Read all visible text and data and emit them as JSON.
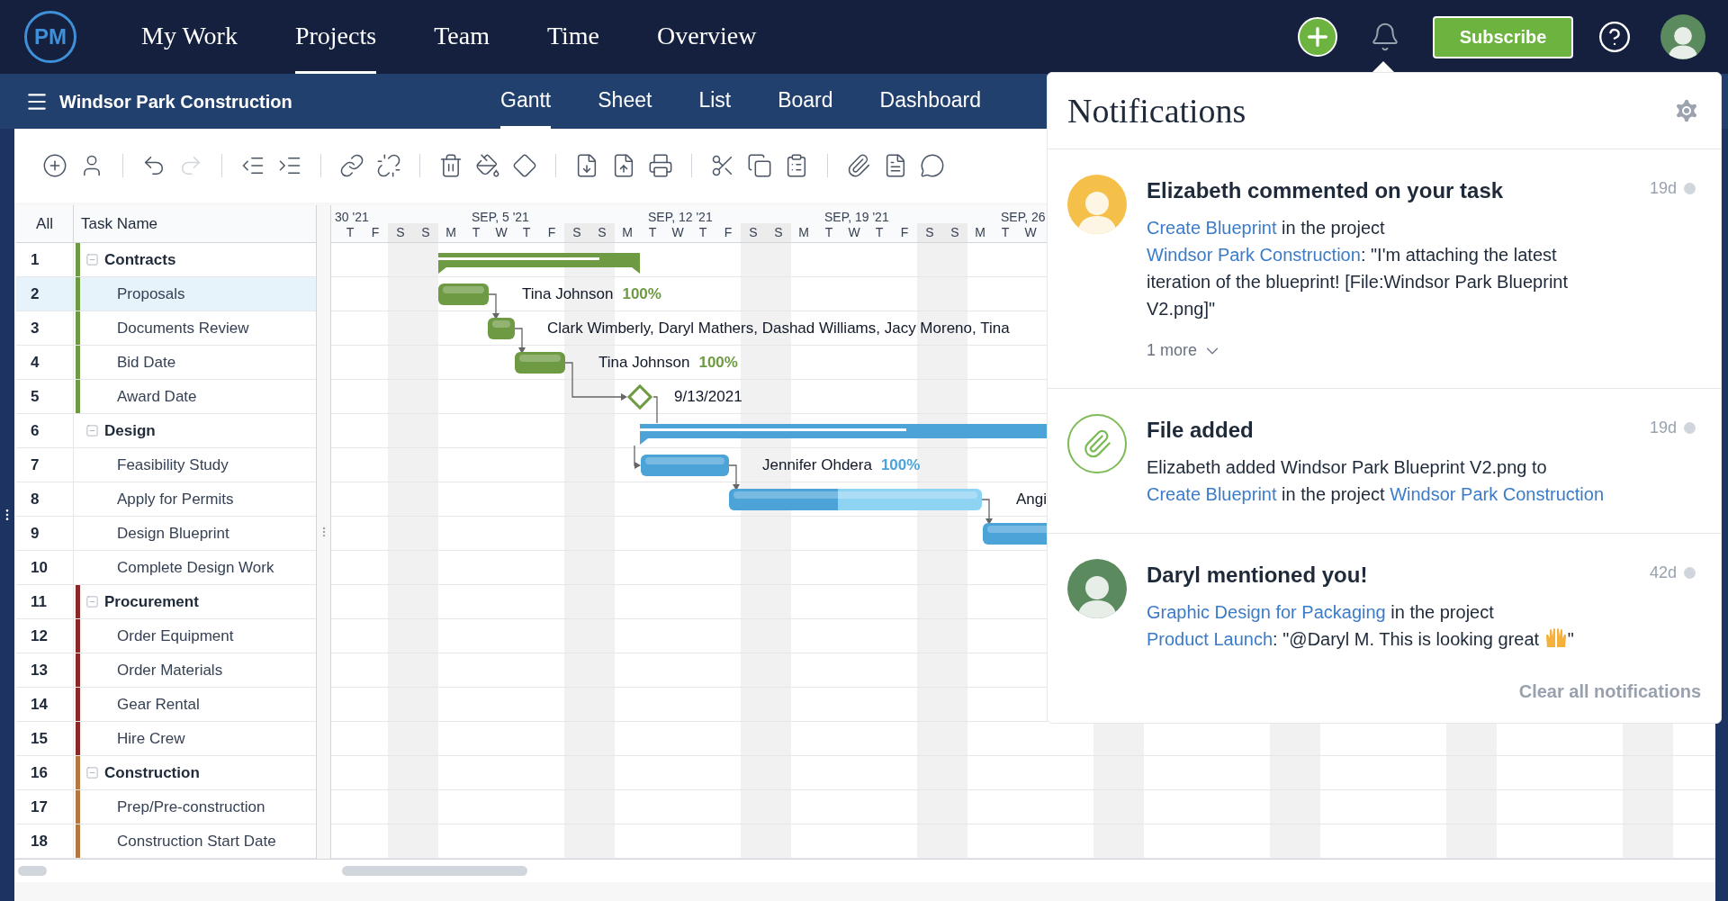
{
  "app": {
    "logo": "PM",
    "nav": [
      {
        "label": "My Work",
        "selected": false
      },
      {
        "label": "Projects",
        "selected": true
      },
      {
        "label": "Team",
        "selected": false
      },
      {
        "label": "Time",
        "selected": false
      },
      {
        "label": "Overview",
        "selected": false
      }
    ],
    "subscribe": "Subscribe"
  },
  "project": {
    "title": "Windsor Park Construction",
    "views": [
      {
        "label": "Gantt",
        "selected": true
      },
      {
        "label": "Sheet",
        "selected": false
      },
      {
        "label": "List",
        "selected": false
      },
      {
        "label": "Board",
        "selected": false
      },
      {
        "label": "Dashboard",
        "selected": false
      }
    ]
  },
  "toolbar": [
    {
      "kind": "add",
      "disabled": false
    },
    {
      "kind": "user",
      "disabled": false
    },
    {
      "kind": "sep"
    },
    {
      "kind": "undo",
      "disabled": false
    },
    {
      "kind": "redo",
      "disabled": true
    },
    {
      "kind": "sep"
    },
    {
      "kind": "outdent",
      "disabled": false
    },
    {
      "kind": "indent",
      "disabled": false
    },
    {
      "kind": "sep"
    },
    {
      "kind": "link",
      "disabled": false
    },
    {
      "kind": "unlink",
      "disabled": false
    },
    {
      "kind": "sep"
    },
    {
      "kind": "trash",
      "disabled": false
    },
    {
      "kind": "paint",
      "disabled": false
    },
    {
      "kind": "diamond",
      "disabled": false
    },
    {
      "kind": "sep"
    },
    {
      "kind": "import",
      "disabled": false
    },
    {
      "kind": "export",
      "disabled": false
    },
    {
      "kind": "print",
      "disabled": false
    },
    {
      "kind": "sep"
    },
    {
      "kind": "cut",
      "disabled": false
    },
    {
      "kind": "copy",
      "disabled": false
    },
    {
      "kind": "paste",
      "disabled": false
    },
    {
      "kind": "sep"
    },
    {
      "kind": "attach",
      "disabled": false
    },
    {
      "kind": "document",
      "disabled": false
    },
    {
      "kind": "comment",
      "disabled": false
    }
  ],
  "grid": {
    "columns": [
      "All",
      "Task Name"
    ],
    "groups": [
      {
        "num": "1",
        "name": "Contracts",
        "color": "#6f9a44",
        "stripe": true,
        "expanded": true,
        "selected": false,
        "level": 0.8,
        "children": [
          {
            "num": "2",
            "name": "Proposals",
            "kind": "task",
            "selected": true,
            "assignee": "Tina Johnson",
            "percent": "100%"
          },
          {
            "num": "3",
            "name": "Documents Review",
            "kind": "task",
            "selected": false,
            "assignee": "Clark Wimberly, Daryl Mathers, Dashad Williams, Jacy Moreno, Tina"
          },
          {
            "num": "4",
            "name": "Bid Date",
            "kind": "task",
            "selected": false,
            "assignee": "Tina Johnson",
            "percent": "100%"
          },
          {
            "num": "5",
            "name": "Award Date",
            "kind": "milestone",
            "selected": false,
            "date": "9/13/2021"
          }
        ]
      },
      {
        "num": "6",
        "name": "Design",
        "color": "#4ba3d8",
        "stripe": false,
        "expanded": true,
        "selected": false,
        "level": 0.39,
        "children": [
          {
            "num": "7",
            "name": "Feasibility Study",
            "kind": "task",
            "selected": false,
            "assignee": "Jennifer Ohdera",
            "percent": "100%"
          },
          {
            "num": "8",
            "name": "Apply for Permits",
            "kind": "task",
            "selected": false,
            "assignee": "Angi",
            "level": 0.43
          },
          {
            "num": "9",
            "name": "Design Blueprint",
            "kind": "task",
            "selected": false
          },
          {
            "num": "10",
            "name": "Complete Design Work",
            "kind": "task",
            "selected": false
          }
        ]
      },
      {
        "num": "11",
        "name": "Procurement",
        "color": "#8b2727",
        "stripe": true,
        "expanded": true,
        "selected": false,
        "children": [
          {
            "num": "12",
            "name": "Order Equipment",
            "kind": "task",
            "selected": false
          },
          {
            "num": "13",
            "name": "Order Materials",
            "kind": "task",
            "selected": false
          },
          {
            "num": "14",
            "name": "Gear Rental",
            "kind": "task",
            "selected": false
          },
          {
            "num": "15",
            "name": "Hire Crew",
            "kind": "task",
            "selected": false
          }
        ]
      },
      {
        "num": "16",
        "name": "Construction",
        "color": "#b5773f",
        "stripe": true,
        "expanded": true,
        "selected": false,
        "children": [
          {
            "num": "17",
            "name": "Prep/Pre-construction",
            "kind": "task",
            "selected": false
          },
          {
            "num": "18",
            "name": "Construction Start Date",
            "kind": "task",
            "selected": false
          }
        ]
      }
    ]
  },
  "timeline": {
    "weeks": [
      "30 '21",
      "SEP, 5 '21",
      "SEP, 12 '21",
      "SEP, 19 '21",
      "SEP, 26"
    ],
    "days": [
      {
        "label": "T",
        "weekend": false
      },
      {
        "label": "F",
        "weekend": false
      },
      {
        "label": "S",
        "weekend": true
      },
      {
        "label": "S",
        "weekend": true
      },
      {
        "label": "M",
        "weekend": false
      },
      {
        "label": "T",
        "weekend": false
      },
      {
        "label": "W",
        "weekend": false
      },
      {
        "label": "T",
        "weekend": false
      },
      {
        "label": "F",
        "weekend": false
      },
      {
        "label": "S",
        "weekend": true
      },
      {
        "label": "S",
        "weekend": true
      },
      {
        "label": "M",
        "weekend": false
      },
      {
        "label": "T",
        "weekend": false
      },
      {
        "label": "W",
        "weekend": false
      },
      {
        "label": "T",
        "weekend": false
      },
      {
        "label": "F",
        "weekend": false
      },
      {
        "label": "S",
        "weekend": true
      },
      {
        "label": "S",
        "weekend": true
      },
      {
        "label": "M",
        "weekend": false
      },
      {
        "label": "T",
        "weekend": false
      },
      {
        "label": "W",
        "weekend": false
      },
      {
        "label": "T",
        "weekend": false
      },
      {
        "label": "F",
        "weekend": false
      },
      {
        "label": "S",
        "weekend": true
      },
      {
        "label": "S",
        "weekend": true
      },
      {
        "label": "M",
        "weekend": false
      },
      {
        "label": "T",
        "weekend": false
      },
      {
        "label": "W",
        "weekend": false
      }
    ]
  },
  "notifications": {
    "title": "Notifications",
    "items": [
      {
        "kind": "person",
        "color": "#f5c04a",
        "title": "Elizabeth commented on your task",
        "age": "19d",
        "more": "1 more",
        "body": [
          {
            "kind": "link",
            "text": "Create Blueprint"
          },
          {
            "kind": "text",
            "text": " in the project "
          },
          {
            "kind": "link",
            "text": "Windsor Park Construction"
          },
          {
            "kind": "text",
            "text": ": \"I'm attaching the latest iteration of the blueprint! [File:Windsor Park Blueprint V2.png]\""
          }
        ]
      },
      {
        "kind": "file",
        "title": "File added",
        "age": "19d",
        "body": [
          {
            "kind": "text",
            "text": "Elizabeth added Windsor Park Blueprint V2.png to "
          },
          {
            "kind": "link",
            "text": "Create Blueprint"
          },
          {
            "kind": "text",
            "text": " in the project "
          },
          {
            "kind": "link",
            "text": "Windsor Park Construction"
          }
        ]
      },
      {
        "kind": "person",
        "color": "#5a8a5e",
        "title": "Daryl mentioned you!",
        "age": "42d",
        "body": [
          {
            "kind": "link",
            "text": "Graphic Design for Packaging"
          },
          {
            "kind": "text",
            "text": " in the project "
          },
          {
            "kind": "link",
            "text": "Product Launch"
          },
          {
            "kind": "text",
            "text": ": \"@Daryl M. This is looking great "
          },
          {
            "kind": "icon"
          },
          {
            "kind": "text",
            "text": "\""
          }
        ]
      }
    ],
    "clear": "Clear all notifications"
  }
}
